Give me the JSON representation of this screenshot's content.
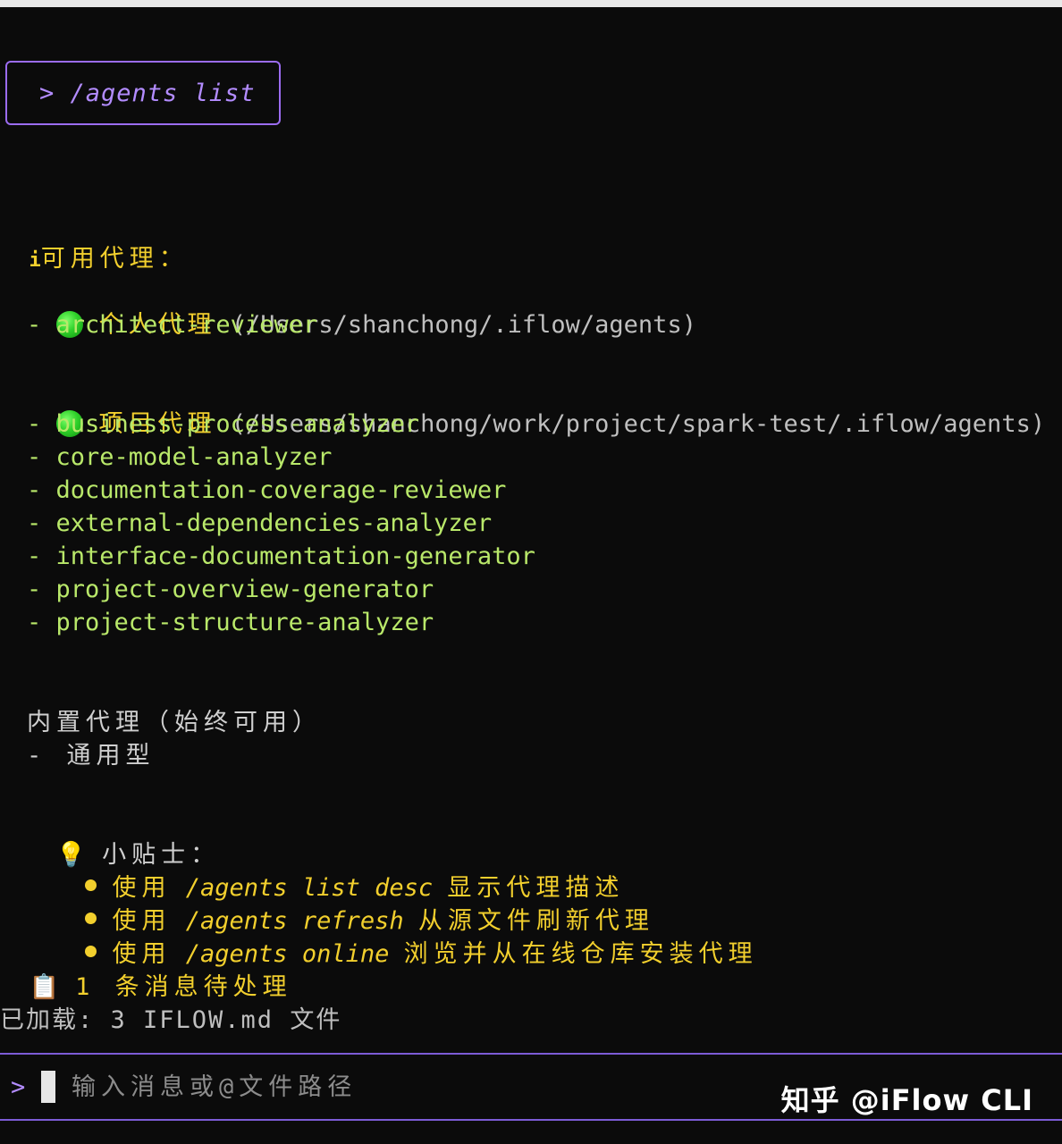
{
  "command": {
    "prompt": ">",
    "text": "/agents list"
  },
  "header": {
    "info_icon": "i",
    "title": "可用代理："
  },
  "personal": {
    "title": "个人代理",
    "path": "(/Users/shanchong/.iflow/agents)",
    "items": [
      "- architect-reviewer"
    ]
  },
  "project": {
    "title": "项目代理",
    "path": "(/Users/shanchong/work/project/spark-test/.iflow/agents)",
    "items": [
      "- business-process-analyzer",
      "- core-model-analyzer",
      "- documentation-coverage-reviewer",
      "- external-dependencies-analyzer",
      "- interface-documentation-generator",
      "- project-overview-generator",
      "- project-structure-analyzer"
    ]
  },
  "builtin": {
    "title": "内置代理（始终可用）",
    "items": [
      "- 通用型"
    ]
  },
  "tips": {
    "icon": "💡",
    "title": "小贴士：",
    "items": [
      {
        "prefix": "使用",
        "cmd": "/agents list desc",
        "desc": "显示代理描述"
      },
      {
        "prefix": "使用",
        "cmd": "/agents refresh",
        "desc": "从源文件刷新代理"
      },
      {
        "prefix": "使用",
        "cmd": "/agents online",
        "desc": "浏览并从在线仓库安装代理"
      }
    ]
  },
  "pending": {
    "icon": "📋",
    "text": "1 条消息待处理"
  },
  "loaded": {
    "text": "已加载: 3 IFLOW.md 文件"
  },
  "input": {
    "prompt": ">",
    "placeholder": "输入消息或@文件路径"
  },
  "watermark": "知乎 @iFlow CLI",
  "colors": {
    "background": "#0b0b0b",
    "accent_purple": "#9b6cf0",
    "yellow": "#f2cf2d",
    "green": "#b9e86a",
    "status_dot": "#2fd12a"
  }
}
